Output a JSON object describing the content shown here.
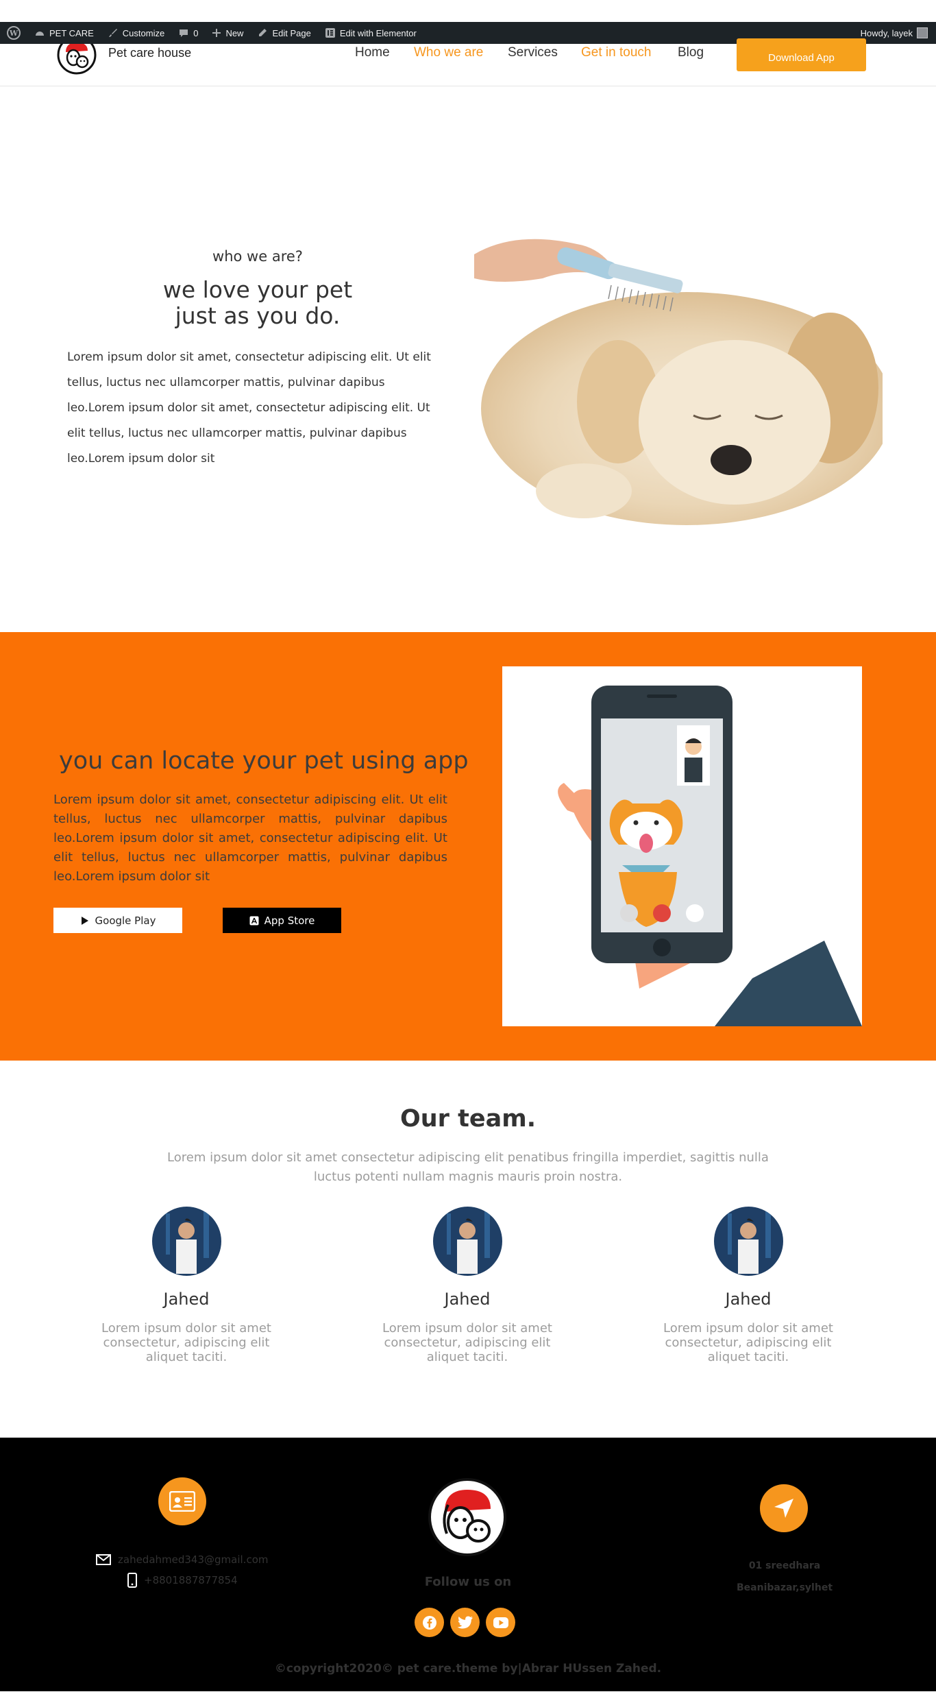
{
  "admin_bar": {
    "site": "PET CARE",
    "customize": "Customize",
    "comments": "0",
    "new": "New",
    "edit_page": "Edit Page",
    "edit_elementor": "Edit with Elementor",
    "howdy": "Howdy, layek"
  },
  "header": {
    "site_title": "Pet care house",
    "nav": [
      {
        "label": "Home",
        "active": false
      },
      {
        "label": "Who we are",
        "active": true
      },
      {
        "label": "Services",
        "active": false
      },
      {
        "label": "Get in touch",
        "active": true
      },
      {
        "label": "Blog",
        "active": false
      }
    ],
    "cta": "Download App"
  },
  "who": {
    "kicker": "who we are?",
    "title_line1": "we love your pet",
    "title_line2": "just as you do.",
    "body": "Lorem ipsum dolor sit amet, consectetur adipiscing elit. Ut elit tellus, luctus nec ullamcorper mattis, pulvinar dapibus leo.Lorem ipsum dolor sit amet, consectetur adipiscing elit. Ut elit tellus, luctus nec ullamcorper mattis, pulvinar dapibus leo.Lorem ipsum dolor sit"
  },
  "locate": {
    "title": "you can locate your pet using app",
    "body": "Lorem ipsum dolor sit amet, consectetur adipiscing elit. Ut elit tellus, luctus nec ullamcorper mattis, pulvinar dapibus leo.Lorem ipsum dolor sit amet, consectetur adipiscing elit. Ut elit tellus, luctus nec ullamcorper mattis, pulvinar dapibus leo.Lorem ipsum dolor sit",
    "google_play": "Google Play",
    "app_store": "App Store"
  },
  "team": {
    "title": "Our team.",
    "subtitle": "Lorem ipsum dolor sit amet consectetur adipiscing elit penatibus fringilla imperdiet, sagittis nulla luctus potenti nullam magnis mauris proin nostra.",
    "members": [
      {
        "name": "Jahed",
        "bio": "Lorem ipsum dolor sit amet consectetur, adipiscing elit aliquet taciti."
      },
      {
        "name": "Jahed",
        "bio": "Lorem ipsum dolor sit amet consectetur, adipiscing elit aliquet taciti."
      },
      {
        "name": "Jahed",
        "bio": "Lorem ipsum dolor sit amet consectetur, adipiscing elit aliquet taciti."
      }
    ]
  },
  "footer": {
    "email": "zahedahmed343@gmail.com",
    "phone": "+8801887877854",
    "follow": "Follow us on",
    "address_line1": "01 sreedhara",
    "address_line2": "Beanibazar,sylhet",
    "copyright": "©copyright2020© pet care.theme by|Abrar HUssen Zahed."
  },
  "colors": {
    "accent": "#f6961e",
    "band": "#fa7105",
    "footer": "#000000",
    "admin_bar": "#1d2327"
  }
}
